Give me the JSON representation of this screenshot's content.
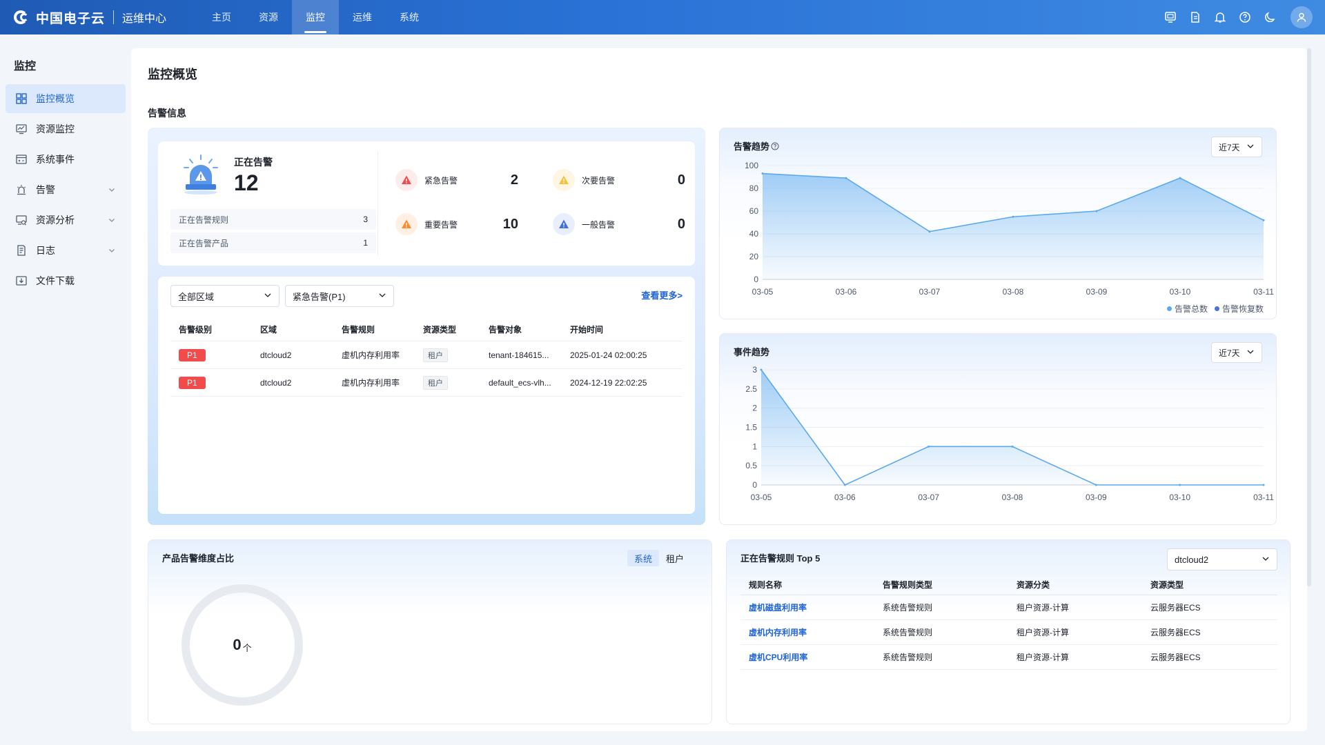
{
  "header": {
    "brand": "中国电子云",
    "subtitle": "运维中心",
    "nav": [
      {
        "label": "主页",
        "active": false
      },
      {
        "label": "资源",
        "active": false
      },
      {
        "label": "监控",
        "active": true
      },
      {
        "label": "运维",
        "active": false
      },
      {
        "label": "系统",
        "active": false
      }
    ],
    "icons": [
      "screen-icon",
      "document-icon",
      "bell-icon",
      "help-icon",
      "moon-icon",
      "user-icon"
    ]
  },
  "sidebar": {
    "title": "监控",
    "items": [
      {
        "label": "监控概览",
        "icon": "dashboard-icon",
        "active": true,
        "expandable": false
      },
      {
        "label": "资源监控",
        "icon": "monitor-icon",
        "active": false,
        "expandable": false
      },
      {
        "label": "系统事件",
        "icon": "event-icon",
        "active": false,
        "expandable": false
      },
      {
        "label": "告警",
        "icon": "alarm-icon",
        "active": false,
        "expandable": true
      },
      {
        "label": "资源分析",
        "icon": "analysis-icon",
        "active": false,
        "expandable": true
      },
      {
        "label": "日志",
        "icon": "log-icon",
        "active": false,
        "expandable": true
      },
      {
        "label": "文件下载",
        "icon": "download-icon",
        "active": false,
        "expandable": false
      }
    ]
  },
  "page": {
    "title": "监控概览",
    "section_title": "告警信息"
  },
  "ongoing": {
    "label": "正在告警",
    "count": "12",
    "rules_label": "正在告警规则",
    "rules_value": "3",
    "products_label": "正在告警产品",
    "products_value": "1",
    "levels": [
      {
        "label": "紧急告警",
        "value": "2",
        "color": "#f14b4b"
      },
      {
        "label": "次要告警",
        "value": "0",
        "color": "#f7c23a"
      },
      {
        "label": "重要告警",
        "value": "10",
        "color": "#ff8a2b"
      },
      {
        "label": "一般告警",
        "value": "0",
        "color": "#3f6fe0"
      }
    ]
  },
  "alarm_list": {
    "region_select": "全部区域",
    "level_select": "紧急告警(P1)",
    "more_link": "查看更多>",
    "columns": [
      "告警级别",
      "区域",
      "告警规则",
      "资源类型",
      "告警对象",
      "开始时间"
    ],
    "rows": [
      {
        "level": "P1",
        "region": "dtcloud2",
        "rule": "虚机内存利用率",
        "type": "租户",
        "object": "tenant-184615...",
        "start": "2025-01-24 02:00:25"
      },
      {
        "level": "P1",
        "region": "dtcloud2",
        "rule": "虚机内存利用率",
        "type": "租户",
        "object": "default_ecs-vlh...",
        "start": "2024-12-19 22:02:25"
      }
    ]
  },
  "alarm_trend": {
    "title": "告警趋势",
    "range": "近7天",
    "legend": [
      {
        "name": "告警总数",
        "color": "#5aa9ef"
      },
      {
        "name": "告警恢复数",
        "color": "#4a73d9"
      }
    ]
  },
  "event_trend": {
    "title": "事件趋势",
    "range": "近7天"
  },
  "chart_data": [
    {
      "type": "area",
      "title": "告警趋势",
      "x": [
        "03-05",
        "03-06",
        "03-07",
        "03-08",
        "03-09",
        "03-10",
        "03-11"
      ],
      "yticks": [
        0,
        20,
        40,
        60,
        80,
        100
      ],
      "ylim": [
        0,
        100
      ],
      "grid": true,
      "legend_position": "bottom-right",
      "series": [
        {
          "name": "告警总数",
          "values": [
            93,
            89,
            42,
            55,
            60,
            89,
            52
          ]
        },
        {
          "name": "告警恢复数",
          "values": [
            0,
            0,
            0,
            0,
            0,
            0,
            0
          ]
        }
      ]
    },
    {
      "type": "area",
      "title": "事件趋势",
      "x": [
        "03-05",
        "03-06",
        "03-07",
        "03-08",
        "03-09",
        "03-10",
        "03-11"
      ],
      "yticks": [
        0,
        0.5,
        1,
        1.5,
        2,
        2.5,
        3
      ],
      "ylim": [
        0,
        3
      ],
      "grid": true,
      "series": [
        {
          "values": [
            3,
            0,
            1,
            1,
            0,
            0,
            0
          ]
        }
      ]
    }
  ],
  "product_ratio": {
    "title": "产品告警维度占比",
    "tabs": [
      {
        "label": "系统",
        "active": true
      },
      {
        "label": "租户",
        "active": false
      }
    ],
    "total": "0",
    "unit": "个"
  },
  "top5": {
    "title": "正在告警规则 Top 5",
    "region": "dtcloud2",
    "columns": [
      "规则名称",
      "告警规则类型",
      "资源分类",
      "资源类型"
    ],
    "rows": [
      {
        "name": "虚机磁盘利用率",
        "rule_type": "系统告警规则",
        "category": "租户资源-计算",
        "resource": "云服务器ECS"
      },
      {
        "name": "虚机内存利用率",
        "rule_type": "系统告警规则",
        "category": "租户资源-计算",
        "resource": "云服务器ECS"
      },
      {
        "name": "虚机CPU利用率",
        "rule_type": "系统告警规则",
        "category": "租户资源-计算",
        "resource": "云服务器ECS"
      }
    ]
  }
}
